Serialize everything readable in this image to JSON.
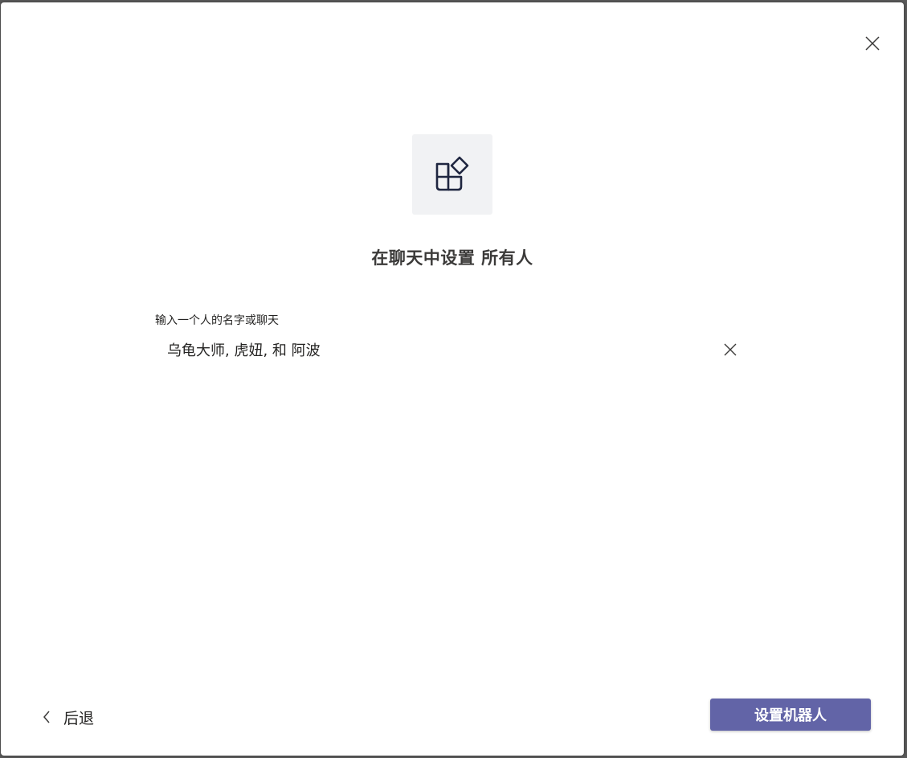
{
  "dialog": {
    "title": "在聊天中设置 所有人",
    "close_icon": "close-icon",
    "app_icon": "apps-icon"
  },
  "recipient_field": {
    "label": "输入一个人的名字或聊天",
    "value": "乌龟大师, 虎妞, 和 阿波",
    "clear_icon": "close-icon"
  },
  "footer": {
    "back_label": "后退",
    "back_icon": "chevron-left-icon",
    "primary_label": "设置机器人"
  },
  "colors": {
    "accent": "#6264a7",
    "tile_bg": "#f1f2f4",
    "icon_stroke": "#1f2640"
  }
}
